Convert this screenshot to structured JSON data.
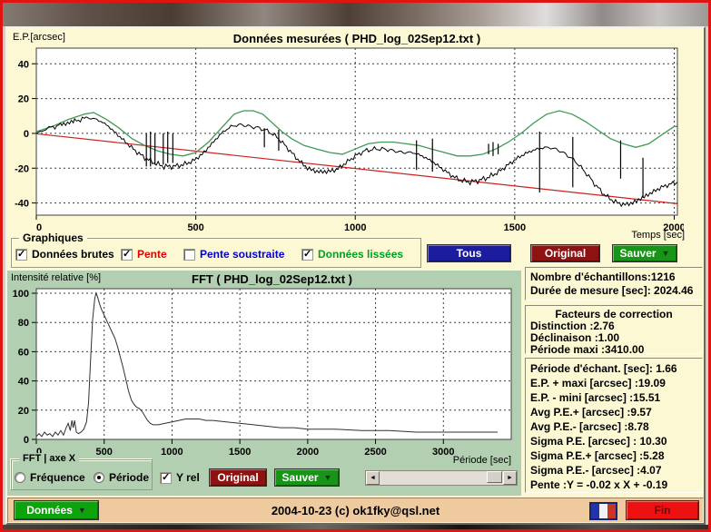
{
  "colors": {
    "accent_red": "#e01410",
    "panel_yellow": "#fcf8d4",
    "fft_green": "#b2cfb2",
    "bar_tan": "#eeca9e",
    "btn_navy": "#1c1c9e",
    "btn_darkred": "#8e1212",
    "btn_green": "#189418",
    "fin_red": "#ee1111",
    "series_raw": "#000000",
    "series_smooth": "#3f9a55",
    "series_trend": "#cc2222"
  },
  "top_chart": {
    "title": "Données mesurées ( PHD_log_02Sep12.txt )",
    "y_label": "E.P.[arcsec]",
    "x_label": "Temps [sec]"
  },
  "graphiques": {
    "legend": "Graphiques",
    "checkboxes": [
      {
        "label": "Données brutes",
        "checked": true,
        "color": "black"
      },
      {
        "label": "Pente",
        "checked": true,
        "color": "red"
      },
      {
        "label": "Pente soustraite",
        "checked": false,
        "color": "blue"
      },
      {
        "label": "Données lissées",
        "checked": true,
        "color": "green"
      }
    ],
    "buttons": {
      "tous": "Tous",
      "original": "Original",
      "sauver": "Sauver"
    }
  },
  "fft": {
    "title": "FFT ( PHD_log_02Sep12.txt )",
    "y_label": "Intensité relative [%]",
    "x_label": "Période [sec]",
    "controls": {
      "legend": "FFT | axe X",
      "radios": [
        {
          "label": "Fréquence",
          "selected": false
        },
        {
          "label": "Période",
          "selected": true
        }
      ],
      "yrel": {
        "label": "Y rel",
        "checked": true
      },
      "original": "Original",
      "sauver": "Sauver"
    }
  },
  "stats": {
    "box1": {
      "lines": [
        "Nombre d'échantillons:1216",
        "Durée de mesure [sec]: 2024.46"
      ]
    },
    "box2": {
      "title": "Facteurs de correction",
      "lines": [
        "Distinction :2.76",
        "Déclinaison :1.00",
        "Période maxi :3410.00"
      ]
    },
    "box3": {
      "lines": [
        "Période d'échant. [sec]: 1.66",
        "E.P. + maxi [arcsec] :19.09",
        "E.P. - mini [arcsec] :15.51",
        "Avg P.E.+ [arcsec] :9.57",
        "Avg P.E.- [arcsec] :8.78",
        "Sigma P.E. [arcsec] : 10.30",
        "Sigma P.E.+ [arcsec] :5.28",
        "Sigma P.E.- [arcsec] :4.07",
        "Pente :Y = -0.02 x X + -0.19"
      ]
    }
  },
  "bottom": {
    "donnees": "Données",
    "credit": "2004-10-23 (c) ok1fky@qsl.net",
    "fin": "Fin"
  },
  "chart_data": [
    {
      "type": "line",
      "title": "Données mesurées ( PHD_log_02Sep12.txt )",
      "xlabel": "Temps [sec]",
      "ylabel": "E.P.[arcsec]",
      "xlim": [
        0,
        2010
      ],
      "ylim": [
        -47,
        49
      ],
      "x_ticks": [
        0,
        500,
        1000,
        1500,
        2000
      ],
      "y_ticks": [
        40,
        20,
        0,
        -20,
        -40
      ],
      "grid": true,
      "legend_position": "none",
      "series": [
        {
          "key": "trend",
          "name": "Pente",
          "color": "#cc2222",
          "width": 1.2,
          "points": [
            [
              0,
              -0.19
            ],
            [
              2010,
              -40.4
            ]
          ]
        },
        {
          "key": "smoothed",
          "name": "Données lissées",
          "color": "#3f9a55",
          "width": 1.3,
          "points": [
            [
              0,
              1
            ],
            [
              50,
              4
            ],
            [
              100,
              8
            ],
            [
              150,
              11
            ],
            [
              180,
              12
            ],
            [
              220,
              8
            ],
            [
              260,
              3
            ],
            [
              300,
              -3
            ],
            [
              340,
              -7
            ],
            [
              380,
              -10
            ],
            [
              420,
              -12
            ],
            [
              460,
              -13
            ],
            [
              500,
              -11
            ],
            [
              540,
              -5
            ],
            [
              580,
              3
            ],
            [
              620,
              11
            ],
            [
              650,
              13
            ],
            [
              680,
              13
            ],
            [
              710,
              11
            ],
            [
              740,
              6
            ],
            [
              770,
              1
            ],
            [
              800,
              -3
            ],
            [
              840,
              -7
            ],
            [
              880,
              -9
            ],
            [
              920,
              -11
            ],
            [
              960,
              -12
            ],
            [
              1000,
              -9
            ],
            [
              1040,
              -6
            ],
            [
              1080,
              -5
            ],
            [
              1120,
              -5
            ],
            [
              1160,
              -6
            ],
            [
              1200,
              -7
            ],
            [
              1240,
              -9
            ],
            [
              1280,
              -11
            ],
            [
              1320,
              -13
            ],
            [
              1360,
              -13
            ],
            [
              1400,
              -12
            ],
            [
              1440,
              -9
            ],
            [
              1480,
              -5
            ],
            [
              1520,
              0
            ],
            [
              1560,
              6
            ],
            [
              1600,
              11
            ],
            [
              1640,
              13
            ],
            [
              1680,
              11
            ],
            [
              1720,
              7
            ],
            [
              1760,
              2
            ],
            [
              1800,
              -3
            ],
            [
              1840,
              -6
            ],
            [
              1880,
              -8
            ],
            [
              1920,
              -6
            ],
            [
              1960,
              -1
            ],
            [
              2000,
              4
            ],
            [
              2010,
              4
            ]
          ]
        },
        {
          "key": "raw",
          "name": "Données brutes",
          "color": "#000000",
          "width": 1,
          "noisy": true,
          "points": [
            [
              0,
              0
            ],
            [
              40,
              3
            ],
            [
              80,
              5
            ],
            [
              120,
              7
            ],
            [
              160,
              9
            ],
            [
              190,
              8
            ],
            [
              220,
              5
            ],
            [
              250,
              0
            ],
            [
              280,
              -5
            ],
            [
              310,
              -10
            ],
            [
              340,
              -14
            ],
            [
              370,
              -17
            ],
            [
              400,
              -19
            ],
            [
              430,
              -19
            ],
            [
              460,
              -18
            ],
            [
              490,
              -16
            ],
            [
              520,
              -12
            ],
            [
              550,
              -6
            ],
            [
              580,
              0
            ],
            [
              610,
              4
            ],
            [
              640,
              5
            ],
            [
              670,
              4
            ],
            [
              700,
              3
            ],
            [
              730,
              1
            ],
            [
              760,
              -3
            ],
            [
              790,
              -9
            ],
            [
              820,
              -15
            ],
            [
              850,
              -20
            ],
            [
              880,
              -22
            ],
            [
              910,
              -22
            ],
            [
              940,
              -21
            ],
            [
              970,
              -17
            ],
            [
              1000,
              -13
            ],
            [
              1030,
              -10
            ],
            [
              1060,
              -9
            ],
            [
              1090,
              -9
            ],
            [
              1120,
              -10
            ],
            [
              1150,
              -11
            ],
            [
              1180,
              -11
            ],
            [
              1210,
              -13
            ],
            [
              1240,
              -16
            ],
            [
              1270,
              -20
            ],
            [
              1300,
              -24
            ],
            [
              1330,
              -27
            ],
            [
              1360,
              -28
            ],
            [
              1390,
              -27
            ],
            [
              1420,
              -25
            ],
            [
              1450,
              -22
            ],
            [
              1480,
              -18
            ],
            [
              1510,
              -14
            ],
            [
              1540,
              -11
            ],
            [
              1570,
              -9
            ],
            [
              1600,
              -8
            ],
            [
              1630,
              -9
            ],
            [
              1660,
              -12
            ],
            [
              1690,
              -16
            ],
            [
              1720,
              -22
            ],
            [
              1750,
              -29
            ],
            [
              1780,
              -35
            ],
            [
              1810,
              -39
            ],
            [
              1840,
              -41
            ],
            [
              1870,
              -40
            ],
            [
              1900,
              -37
            ],
            [
              1930,
              -34
            ],
            [
              1960,
              -31
            ],
            [
              1990,
              -29
            ],
            [
              2010,
              -28
            ]
          ]
        }
      ],
      "dropout_spikes": [
        [
          345,
          0,
          -19
        ],
        [
          358,
          1,
          -19
        ],
        [
          372,
          0,
          -18
        ],
        [
          398,
          0,
          -18
        ],
        [
          412,
          1,
          -17
        ],
        [
          428,
          0,
          -17
        ],
        [
          715,
          3,
          -8
        ],
        [
          760,
          2,
          -10
        ],
        [
          1192,
          -4,
          -21
        ],
        [
          1242,
          -3,
          -22
        ],
        [
          1418,
          -6,
          -12
        ],
        [
          1432,
          -5,
          -13
        ],
        [
          1448,
          -6,
          -12
        ],
        [
          1578,
          1,
          -34
        ],
        [
          1682,
          -2,
          -31
        ],
        [
          1832,
          -4,
          -26
        ],
        [
          1902,
          -14,
          -37
        ]
      ]
    },
    {
      "type": "line",
      "title": "FFT ( PHD_log_02Sep12.txt )",
      "xlabel": "Période [sec]",
      "ylabel": "Intensité relative [%]",
      "xlim": [
        0,
        3500
      ],
      "ylim": [
        0,
        100
      ],
      "x_ticks": [
        0,
        500,
        1000,
        1500,
        2000,
        2500,
        3000
      ],
      "y_ticks": [
        100,
        80,
        60,
        40,
        20,
        0
      ],
      "grid": true,
      "legend_position": "none",
      "series": [
        {
          "key": "fft",
          "name": "FFT",
          "color": "#303030",
          "width": 1,
          "points": [
            [
              0,
              2
            ],
            [
              20,
              4
            ],
            [
              40,
              2
            ],
            [
              60,
              5
            ],
            [
              80,
              3
            ],
            [
              100,
              4
            ],
            [
              120,
              2
            ],
            [
              140,
              5
            ],
            [
              160,
              3
            ],
            [
              180,
              6
            ],
            [
              200,
              3
            ],
            [
              220,
              8
            ],
            [
              235,
              11
            ],
            [
              250,
              6
            ],
            [
              262,
              13
            ],
            [
              272,
              8
            ],
            [
              282,
              13
            ],
            [
              295,
              5
            ],
            [
              310,
              4
            ],
            [
              330,
              5
            ],
            [
              350,
              7
            ],
            [
              370,
              12
            ],
            [
              385,
              25
            ],
            [
              400,
              55
            ],
            [
              415,
              82
            ],
            [
              430,
              96
            ],
            [
              440,
              100
            ],
            [
              450,
              98
            ],
            [
              465,
              93
            ],
            [
              480,
              89
            ],
            [
              500,
              85
            ],
            [
              520,
              81
            ],
            [
              540,
              77
            ],
            [
              560,
              73
            ],
            [
              580,
              69
            ],
            [
              600,
              63
            ],
            [
              620,
              56
            ],
            [
              640,
              49
            ],
            [
              660,
              41
            ],
            [
              680,
              33
            ],
            [
              700,
              27
            ],
            [
              720,
              24
            ],
            [
              740,
              22
            ],
            [
              760,
              21
            ],
            [
              780,
              19
            ],
            [
              800,
              16
            ],
            [
              820,
              13
            ],
            [
              840,
              11
            ],
            [
              860,
              10
            ],
            [
              900,
              10
            ],
            [
              950,
              11
            ],
            [
              1000,
              12
            ],
            [
              1050,
              13
            ],
            [
              1100,
              14
            ],
            [
              1150,
              14
            ],
            [
              1200,
              14
            ],
            [
              1250,
              13
            ],
            [
              1300,
              13
            ],
            [
              1400,
              12
            ],
            [
              1500,
              11
            ],
            [
              1600,
              10
            ],
            [
              1700,
              9
            ],
            [
              1800,
              8
            ],
            [
              1900,
              8
            ],
            [
              2000,
              7
            ],
            [
              2200,
              7
            ],
            [
              2400,
              6
            ],
            [
              2600,
              6
            ],
            [
              2800,
              5
            ],
            [
              3000,
              5
            ],
            [
              3200,
              5
            ],
            [
              3400,
              5
            ]
          ]
        }
      ]
    }
  ]
}
